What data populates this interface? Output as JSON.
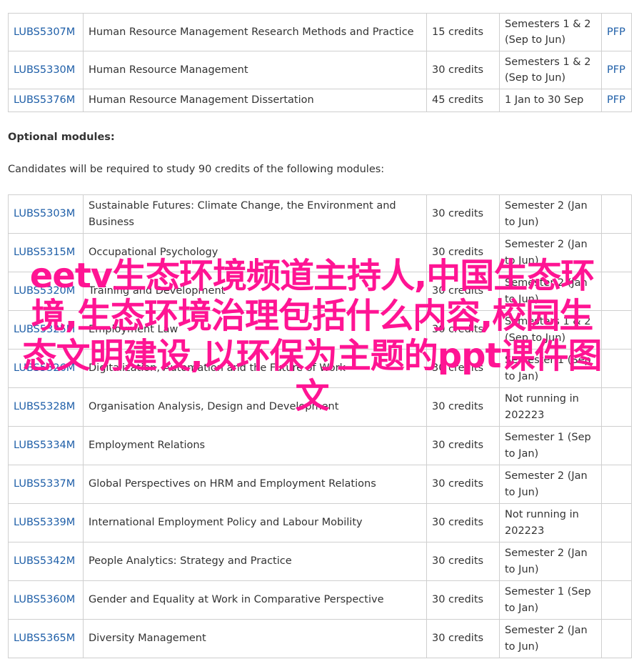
{
  "core_modules": [
    {
      "code": "LUBS5307M",
      "title": "Human Resource Management Research Methods and Practice",
      "credits": "15 credits",
      "semester": "Semesters 1 & 2 (Sep to Jun)",
      "pfp": "PFP"
    },
    {
      "code": "LUBS5330M",
      "title": "Human Resource Management",
      "credits": "30 credits",
      "semester": "Semesters 1 & 2 (Sep to Jun)",
      "pfp": "PFP"
    },
    {
      "code": "LUBS5376M",
      "title": "Human Resource Management Dissertation",
      "credits": "45 credits",
      "semester": "1 Jan to 30 Sep",
      "pfp": "PFP"
    }
  ],
  "optional": {
    "heading": "Optional modules:",
    "note": "Candidates will be required to study 90 credits of the following modules:",
    "modules": [
      {
        "code": "LUBS5303M",
        "title": "Sustainable Futures: Climate Change, the Environment and Business",
        "credits": "30 credits",
        "semester": "Semester 2 (Jan to Jun)"
      },
      {
        "code": "LUBS5315M",
        "title": "Occupational Psychology",
        "credits": "30 credits",
        "semester": "Semester 2 (Jan to Jun)"
      },
      {
        "code": "LUBS5320M",
        "title": "Training and Development",
        "credits": "30 credits",
        "semester": "Semester 2 (Jan to Jun)"
      },
      {
        "code": "LUBS5325M",
        "title": "Employment Law",
        "credits": "30 credits",
        "semester": "Semesters 1 & 2 (Sep to Jun)"
      },
      {
        "code": "LUBS5326M",
        "title": "Digitalization, Automation and the Future of Work",
        "credits": "30 credits",
        "semester": "Semester 1 (Sep to Jan)"
      },
      {
        "code": "LUBS5328M",
        "title": "Organisation Analysis, Design and Development",
        "credits": "30 credits",
        "semester": "Not running in 202223"
      },
      {
        "code": "LUBS5334M",
        "title": "Employment Relations",
        "credits": "30 credits",
        "semester": "Semester 1 (Sep to Jan)"
      },
      {
        "code": "LUBS5337M",
        "title": "Global Perspectives on HRM and Employment Relations",
        "credits": "30 credits",
        "semester": "Semester 2 (Jan to Jun)"
      },
      {
        "code": "LUBS5339M",
        "title": "International Employment Policy and Labour Mobility",
        "credits": "30 credits",
        "semester": "Not running in 202223"
      },
      {
        "code": "LUBS5342M",
        "title": "People Analytics: Strategy and Practice",
        "credits": "30 credits",
        "semester": "Semester 2 (Jan to Jun)"
      },
      {
        "code": "LUBS5360M",
        "title": "Gender and Equality at Work in Comparative Perspective",
        "credits": "30 credits",
        "semester": "Semester 1 (Sep to Jan)"
      },
      {
        "code": "LUBS5365M",
        "title": "Diversity Management",
        "credits": "30 credits",
        "semester": "Semester 2 (Jan to Jun)"
      }
    ]
  },
  "overlay_text": "eetv生态环境频道主持人,中国生态环境,生态环境治理包括什么内容,校园生态文明建设,以环保为主题的ppt课件图文",
  "colors": {
    "link": "#1f5fa8",
    "overlay": "#ff1493",
    "border": "#cfcfcf",
    "text": "#333333"
  }
}
